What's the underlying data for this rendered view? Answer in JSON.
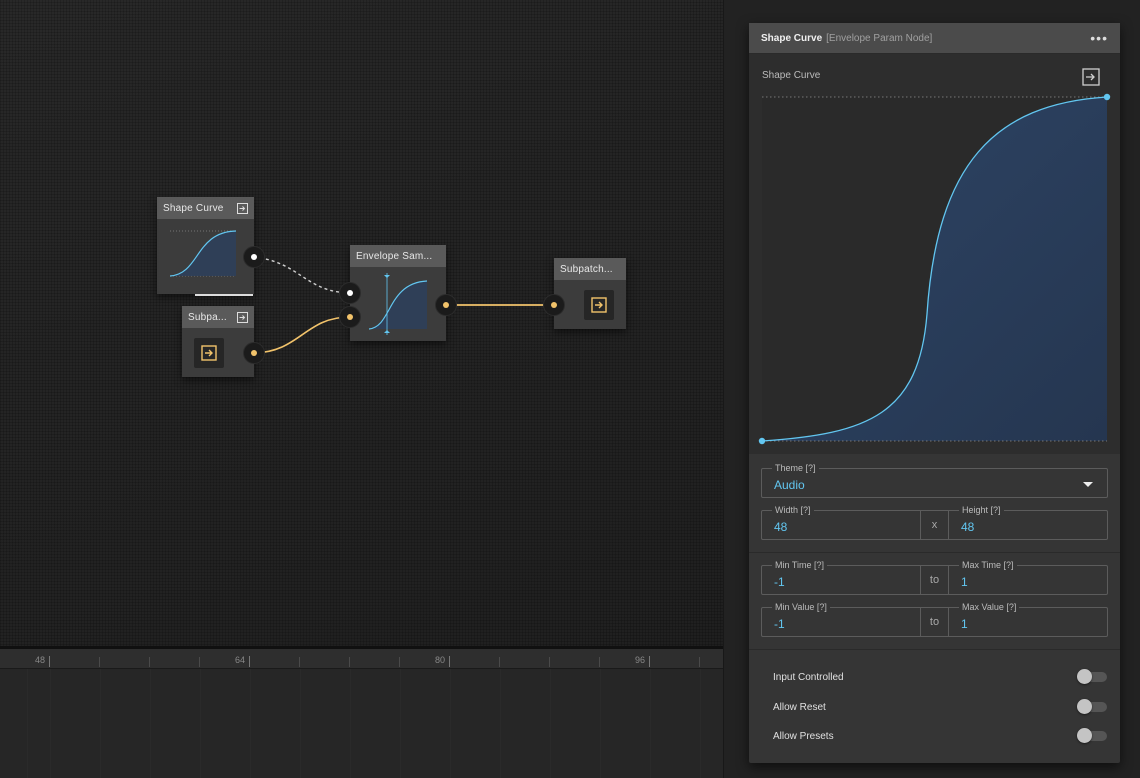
{
  "canvas": {
    "nodes": {
      "shape_curve": {
        "title": "Shape Curve"
      },
      "subpatch_left": {
        "title": "Subpa..."
      },
      "envelope_sampler": {
        "title": "Envelope Sam..."
      },
      "subpatch_right": {
        "title": "Subpatch..."
      }
    }
  },
  "timeline": {
    "ticks": [
      "48",
      "64",
      "80",
      "96"
    ]
  },
  "panel": {
    "title": "Shape Curve",
    "subtitle": "[Envelope Param Node]",
    "menu_icon": "more-dots-icon",
    "curve": {
      "label": "Shape Curve",
      "export_icon": "export-icon",
      "accent": "#62c6f0"
    },
    "theme": {
      "label": "Theme [?]",
      "value": "Audio"
    },
    "width": {
      "label": "Width [?]",
      "value": "48"
    },
    "size_sep": "x",
    "height": {
      "label": "Height [?]",
      "value": "48"
    },
    "min_time": {
      "label": "Min Time [?]",
      "value": "-1"
    },
    "time_sep": "to",
    "max_time": {
      "label": "Max Time [?]",
      "value": "1"
    },
    "min_value": {
      "label": "Min Value [?]",
      "value": "-1"
    },
    "value_sep": "to",
    "max_value": {
      "label": "Max Value [?]",
      "value": "1"
    },
    "toggles": {
      "input_controlled": "Input Controlled",
      "allow_reset": "Allow Reset",
      "allow_presets": "Allow Presets"
    }
  },
  "colors": {
    "wire_audio": "#f2c36b",
    "wire_control": "#cfcfcf",
    "curve": "#62c6f0"
  }
}
